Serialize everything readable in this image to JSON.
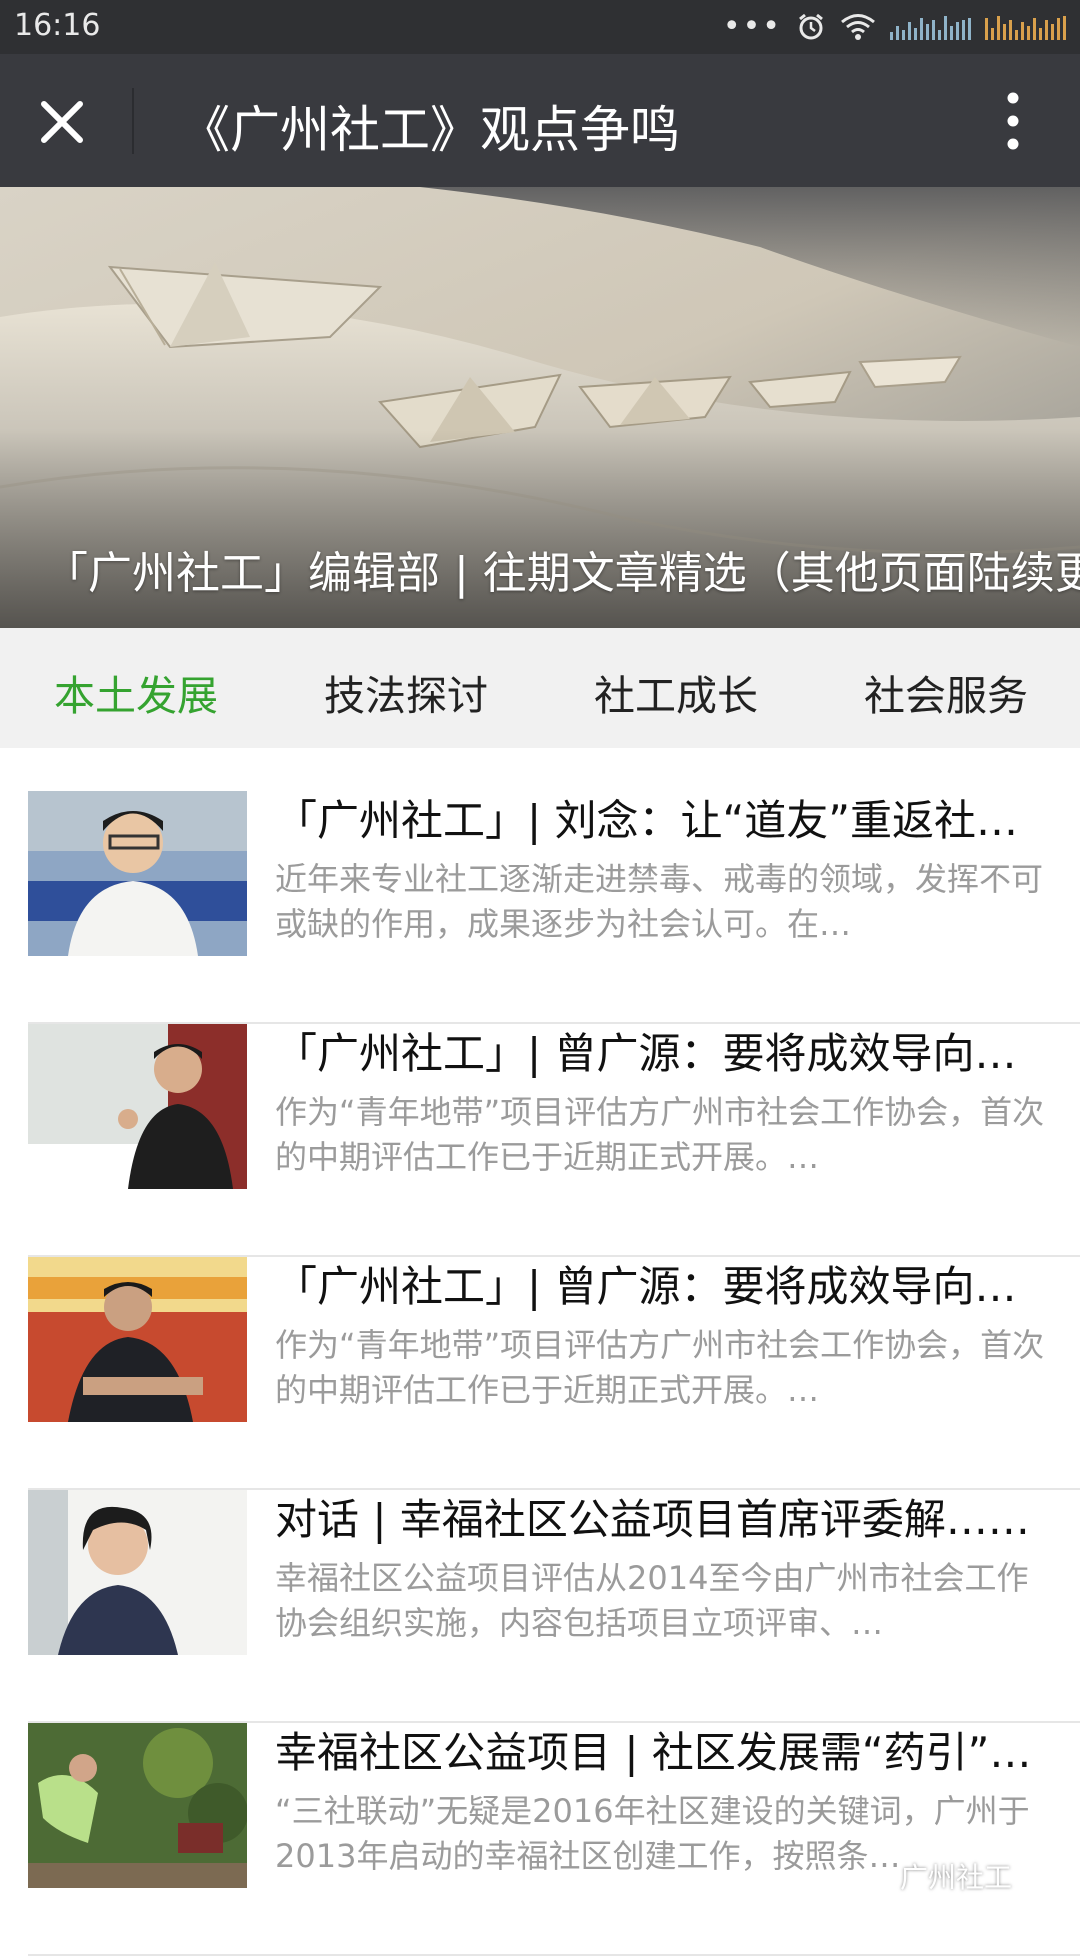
{
  "status_bar": {
    "time": "16:16",
    "dots": "•••"
  },
  "title_bar": {
    "title": "《广州社工》观点争鸣"
  },
  "banner": {
    "caption": "「广州社工」编辑部 | 往期文章精选（其他页面陆续更"
  },
  "tabs": [
    {
      "label": "本土发展",
      "active": true
    },
    {
      "label": "技法探讨",
      "active": false
    },
    {
      "label": "社工成长",
      "active": false
    },
    {
      "label": "社会服务",
      "active": false
    }
  ],
  "articles": [
    {
      "title": "「广州社工」| 刘念：让“道友”重返社会……",
      "desc": "近年来专业社工逐渐走进禁毒、戒毒的领域，发挥不可或缺的作用，成果逐步为社会认可。在…"
    },
    {
      "title": "「广州社工」| 曾广源：要将成效导向……",
      "desc": "作为“青年地带”项目评估方广州市社会工作协会，首次的中期评估工作已于近期正式开展。…"
    },
    {
      "title": "「广州社工」| 曾广源：要将成效导向……",
      "desc": "作为“青年地带”项目评估方广州市社会工作协会，首次的中期评估工作已于近期正式开展。…"
    },
    {
      "title": "对话 | 幸福社区公益项目首席评委解……",
      "desc": "幸福社区公益项目评估从2014至今由广州市社会工作协会组织实施，内容包括项目立项评审、…"
    },
    {
      "title": "幸福社区公益项目 | 社区发展需“药引”…",
      "desc": "“三社联动”无疑是2016年社区建设的关键词，广州于2013年启动的幸福社区创建工作，按照条…"
    }
  ],
  "watermark": "广州社工",
  "colors": {
    "title_bar": "#393a3f",
    "status_bar": "#2f3033",
    "tab_active": "#35a330",
    "tab_bg": "#f1f1f1",
    "desc_text": "#9b9b9b"
  },
  "icons": {
    "close": "close-icon",
    "menu": "more-vertical-icon",
    "alarm": "alarm-icon",
    "wifi": "wifi-icon"
  }
}
